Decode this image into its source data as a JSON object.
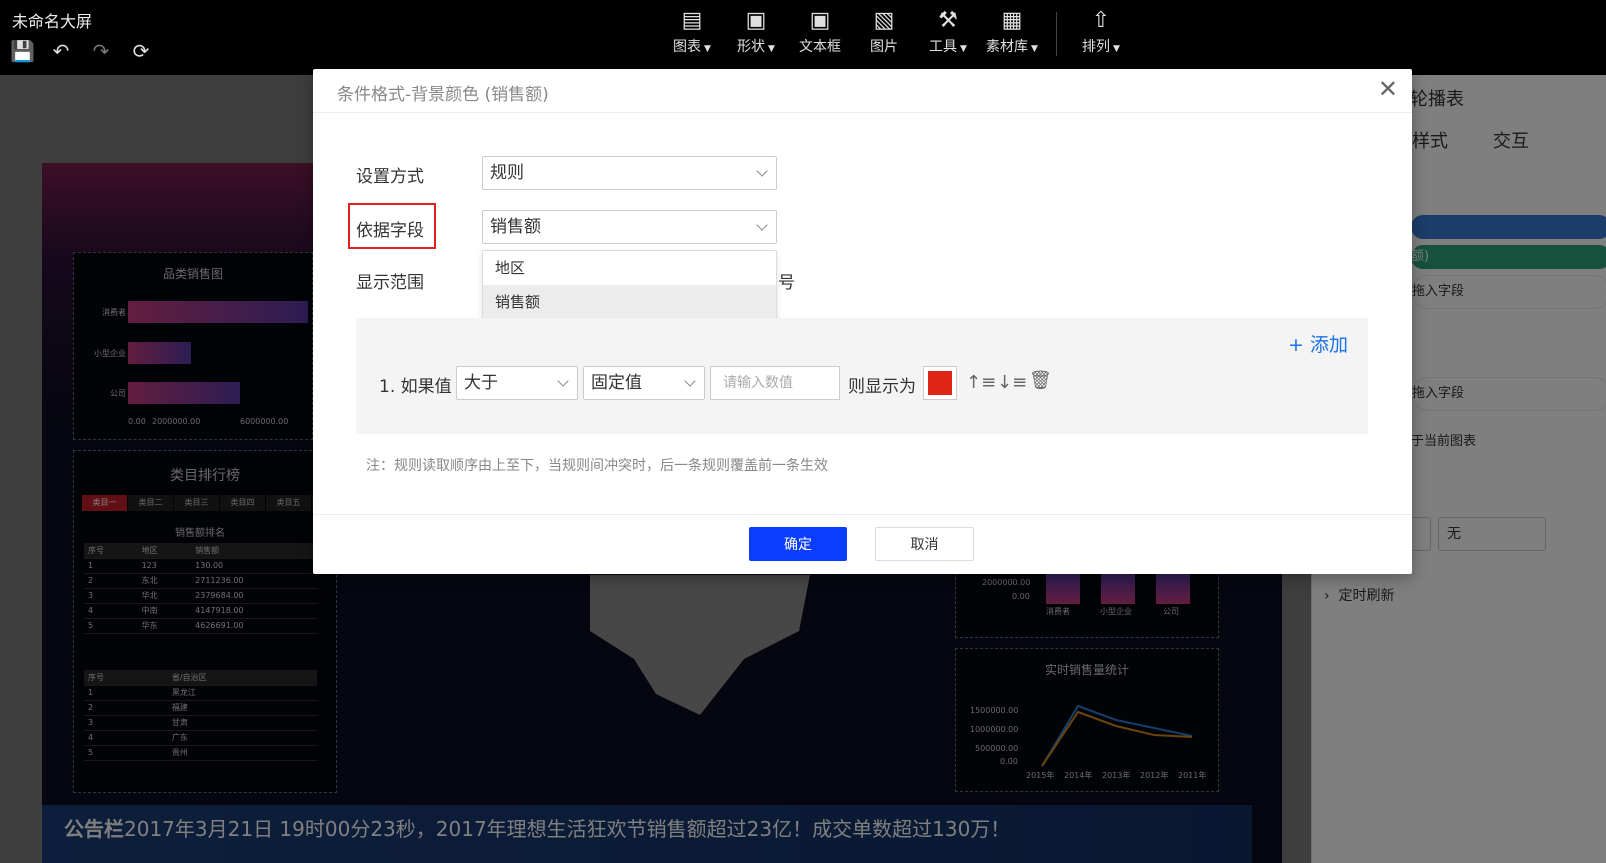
{
  "app": {
    "title": "未命名大屏",
    "toolbar": [
      {
        "label": "图表",
        "icon": "chart-icon",
        "dropdown": true
      },
      {
        "label": "形状",
        "icon": "shape-icon",
        "dropdown": true
      },
      {
        "label": "文本框",
        "icon": "textbox-icon",
        "dropdown": false
      },
      {
        "label": "图片",
        "icon": "image-icon",
        "dropdown": false
      },
      {
        "label": "工具",
        "icon": "tool-icon",
        "dropdown": true
      },
      {
        "label": "素材库",
        "icon": "library-icon",
        "dropdown": true
      },
      {
        "label": "排列",
        "icon": "arrange-icon",
        "dropdown": true
      }
    ]
  },
  "canvas": {
    "bar_chart": {
      "title": "品类销售图",
      "categories": [
        "消费者",
        "小型企业",
        "公司"
      ],
      "values": [
        1.0,
        0.35,
        0.62
      ],
      "ticks": [
        "0.00",
        "2000000.00",
        "6000000.00"
      ]
    },
    "ranking": {
      "title": "类目排行榜",
      "tabs": [
        "类目一",
        "类目二",
        "类目三",
        "类目四",
        "类目五",
        "+"
      ],
      "subtitle": "销售额排名",
      "headers": [
        "序号",
        "地区",
        "销售额"
      ],
      "rows": [
        [
          "1",
          "123",
          "130.00"
        ],
        [
          "2",
          "东北",
          "2711236.00"
        ],
        [
          "3",
          "华北",
          "2379684.00"
        ],
        [
          "4",
          "中南",
          "4147918.00"
        ],
        [
          "5",
          "华东",
          "4626691.00"
        ]
      ]
    },
    "province_table": {
      "headers": [
        "序号",
        "省/自治区"
      ],
      "rows": [
        [
          "1",
          "黑龙江"
        ],
        [
          "2",
          "福建"
        ],
        [
          "3",
          "甘肃"
        ],
        [
          "4",
          "广东"
        ],
        [
          "5",
          "贵州"
        ]
      ]
    },
    "vbar_chart": {
      "ticks": [
        "2000000.00",
        "0.00"
      ],
      "categories": [
        "消费者",
        "小型企业",
        "公司"
      ]
    },
    "line_chart": {
      "title": "实时销售量统计",
      "y_ticks": [
        "1500000.00",
        "1000000.00",
        "500000.00",
        "0.00"
      ],
      "x": [
        "2015年",
        "2014年",
        "2013年",
        "2012年",
        "2011年"
      ]
    },
    "notice": {
      "label": "公告栏",
      "text": "2017年3月21日 19时00分23秒，2017年理想生活狂欢节销售额超过23亿！成交单数超过130万！"
    }
  },
  "right_panel": {
    "title": "轮播表",
    "tabs": [
      "样式",
      "交互"
    ],
    "pill_partial": "额)",
    "drop_field_1": "拖入字段",
    "drop_field_2": "拖入字段",
    "apply_note": "于当前图表",
    "select_value": "无",
    "refresh_label": "定时刷新"
  },
  "modal": {
    "title": "条件格式-背景颜色 (销售额)",
    "method_label": "设置方式",
    "method_value": "规则",
    "field_label": "依据字段",
    "field_value": "销售额",
    "range_label": "显示范围",
    "range_partial": "号",
    "dropdown_options": [
      "地区",
      "销售额"
    ],
    "add_label": "+ 添加",
    "rule": {
      "prefix": "1. 如果值",
      "operator": "大于",
      "value_type": "固定值",
      "value_placeholder": "请输入数值",
      "then_label": "则显示为",
      "color": "#e02617"
    },
    "note": "注：规则读取顺序由上至下，当规则间冲突时，后一条规则覆盖前一条生效",
    "ok_label": "确定",
    "cancel_label": "取消"
  },
  "colors": {
    "primary": "#0b3dff",
    "highlight": "#e02020",
    "link": "#1a73e8"
  }
}
